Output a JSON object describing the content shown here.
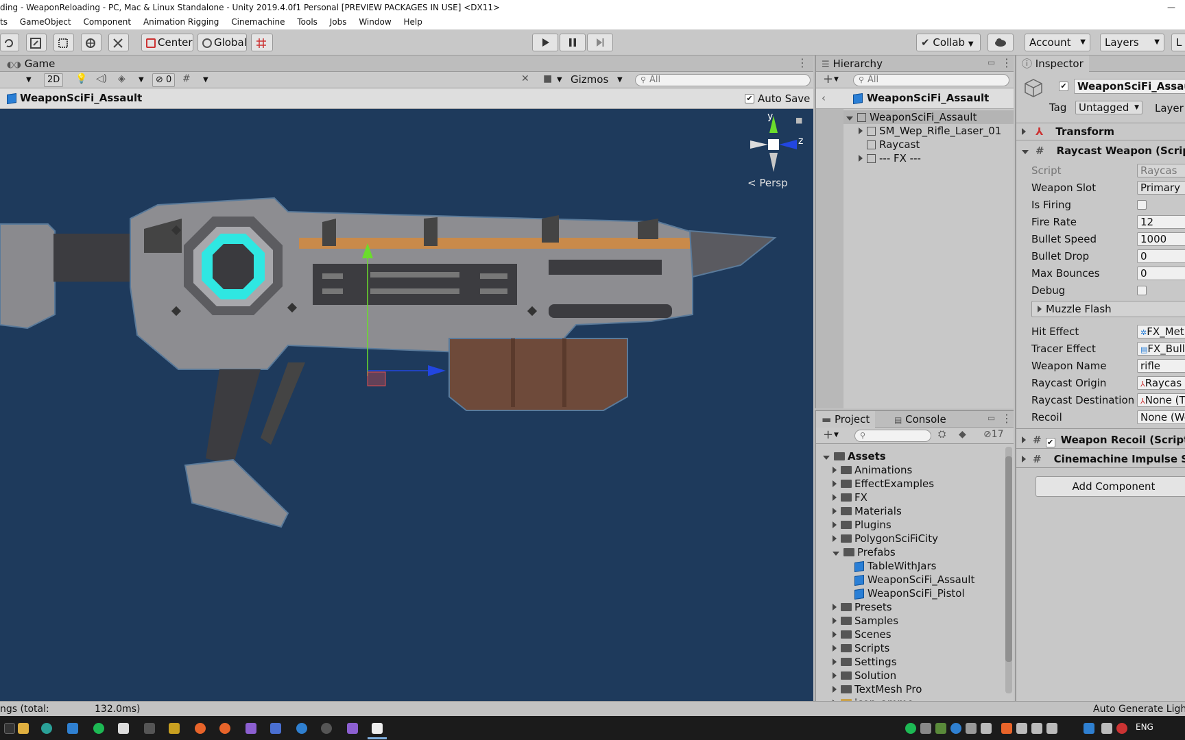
{
  "window": {
    "title": "ding - WeaponReloading - PC, Mac & Linux Standalone - Unity 2019.4.0f1 Personal [PREVIEW PACKAGES IN USE] <DX11>",
    "minimize": "—"
  },
  "menu": [
    "ts",
    "GameObject",
    "Component",
    "Animation Rigging",
    "Cinemachine",
    "Tools",
    "Jobs",
    "Window",
    "Help"
  ],
  "toolbar": {
    "pivot": "Center",
    "space": "Global",
    "collab": "Collab",
    "account": "Account",
    "layers": "Layers",
    "layout": "L"
  },
  "game": {
    "tab": "Game",
    "mode_2d": "2D",
    "hidden_count": "0",
    "gizmos": "Gizmos",
    "search_placeholder": "All",
    "prefab_name": "WeaponSciFi_Assault",
    "auto_save": "Auto Save",
    "persp": "Persp",
    "gizmo_axes": {
      "y": "y",
      "z": "z"
    }
  },
  "hierarchy": {
    "tab": "Hierarchy",
    "search_placeholder": "All",
    "prefab_header": "WeaponSciFi_Assault",
    "items": [
      "WeaponSciFi_Assault",
      "SM_Wep_Rifle_Laser_01",
      "Raycast",
      "--- FX ---"
    ]
  },
  "project": {
    "tab_project": "Project",
    "tab_console": "Console",
    "hidden_count": "17",
    "root": "Assets",
    "folders": [
      "Animations",
      "EffectExamples",
      "FX",
      "Materials",
      "Plugins",
      "PolygonSciFiCity",
      "Prefabs"
    ],
    "prefabs": [
      "TableWithJars",
      "WeaponSciFi_Assault",
      "WeaponSciFi_Pistol"
    ],
    "folders_after": [
      "Presets",
      "Samples",
      "Scenes",
      "Scripts",
      "Settings",
      "Solution",
      "TextMesh Pro"
    ],
    "cut_item": "icon_ammo"
  },
  "inspector": {
    "tab": "Inspector",
    "object_name": "WeaponSciFi_Assault",
    "tag_label": "Tag",
    "tag_value": "Untagged",
    "layer_label": "Layer",
    "transform": "Transform",
    "raycast_weapon": "Raycast Weapon (Scrip",
    "fields": {
      "script": {
        "label": "Script",
        "value": "Raycas"
      },
      "weapon_slot": {
        "label": "Weapon Slot",
        "value": "Primary"
      },
      "is_firing": {
        "label": "Is Firing"
      },
      "fire_rate": {
        "label": "Fire Rate",
        "value": "12"
      },
      "bullet_speed": {
        "label": "Bullet Speed",
        "value": "1000"
      },
      "bullet_drop": {
        "label": "Bullet Drop",
        "value": "0"
      },
      "max_bounces": {
        "label": "Max Bounces",
        "value": "0"
      },
      "debug": {
        "label": "Debug"
      },
      "muzzle_flash": {
        "label": "Muzzle Flash"
      },
      "hit_effect": {
        "label": "Hit Effect",
        "value": "FX_Met"
      },
      "tracer_effect": {
        "label": "Tracer Effect",
        "value": "FX_Bull"
      },
      "weapon_name": {
        "label": "Weapon Name",
        "value": "rifle"
      },
      "raycast_origin": {
        "label": "Raycast Origin",
        "value": "Raycas"
      },
      "raycast_destination": {
        "label": "Raycast Destination",
        "value": "None (T"
      },
      "recoil": {
        "label": "Recoil",
        "value": "None (We"
      }
    },
    "weapon_recoil": "Weapon Recoil (Script)",
    "cinemachine_impulse": "Cinemachine Impulse S",
    "add_component": "Add Component"
  },
  "status": {
    "left": "ngs (total:",
    "time": "132.0ms)",
    "right": "Auto Generate Ligh"
  },
  "taskbar": {
    "lang": "ENG",
    "colors": {
      "spotify": "#1db954",
      "vscode": "#2f80d1",
      "firefox": "#e8642a",
      "vs": "#8c5fd1"
    }
  }
}
